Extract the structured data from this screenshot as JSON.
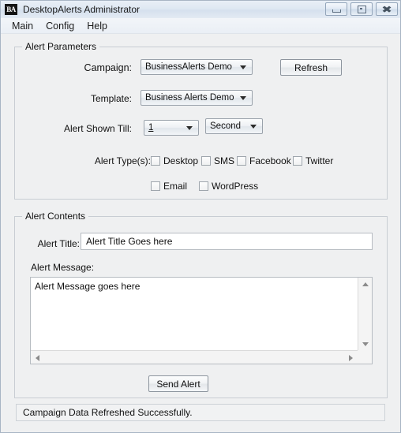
{
  "window": {
    "icon_text": "BA",
    "title": "DesktopAlerts Administrator",
    "controls": [
      {
        "name": "minimize",
        "glyph": "minimize-icon"
      },
      {
        "name": "restore",
        "glyph": "restore-icon"
      },
      {
        "name": "close",
        "glyph": "close-icon",
        "label": "✖"
      }
    ]
  },
  "menubar": {
    "items": [
      {
        "label": "Main"
      },
      {
        "label": "Config"
      },
      {
        "label": "Help"
      }
    ]
  },
  "alert_parameters": {
    "legend": "Alert Parameters",
    "campaign": {
      "label": "Campaign:",
      "value": "BusinessAlerts Demo"
    },
    "template": {
      "label": "Template:",
      "value": "Business Alerts Demo"
    },
    "shown_till": {
      "label": "Alert Shown Till:",
      "amount_value": "1",
      "unit_value": "Second"
    },
    "refresh_button": "Refresh",
    "alert_types": {
      "label": "Alert Type(s):",
      "row1": [
        {
          "label": "Desktop",
          "checked": false
        },
        {
          "label": "SMS",
          "checked": false
        },
        {
          "label": "Facebook",
          "checked": false
        },
        {
          "label": "Twitter",
          "checked": false
        }
      ],
      "row2": [
        {
          "label": "Email",
          "checked": false
        },
        {
          "label": "WordPress",
          "checked": false
        }
      ]
    }
  },
  "alert_contents": {
    "legend": "Alert Contents",
    "title_field": {
      "label": "Alert Title:",
      "value": "Alert Title Goes here"
    },
    "message_field": {
      "label": "Alert Message:",
      "value": "Alert Message goes here"
    },
    "send_button": "Send Alert"
  },
  "statusbar": {
    "message": "Campaign Data Refreshed Successfully."
  },
  "colors": {
    "window_background": "#eff0f1",
    "titlebar_top": "#e9eff6",
    "titlebar_bottom": "#e3eaf3",
    "group_border": "#c8cdd3",
    "field_background": "#ffffff",
    "text": "#111111"
  }
}
